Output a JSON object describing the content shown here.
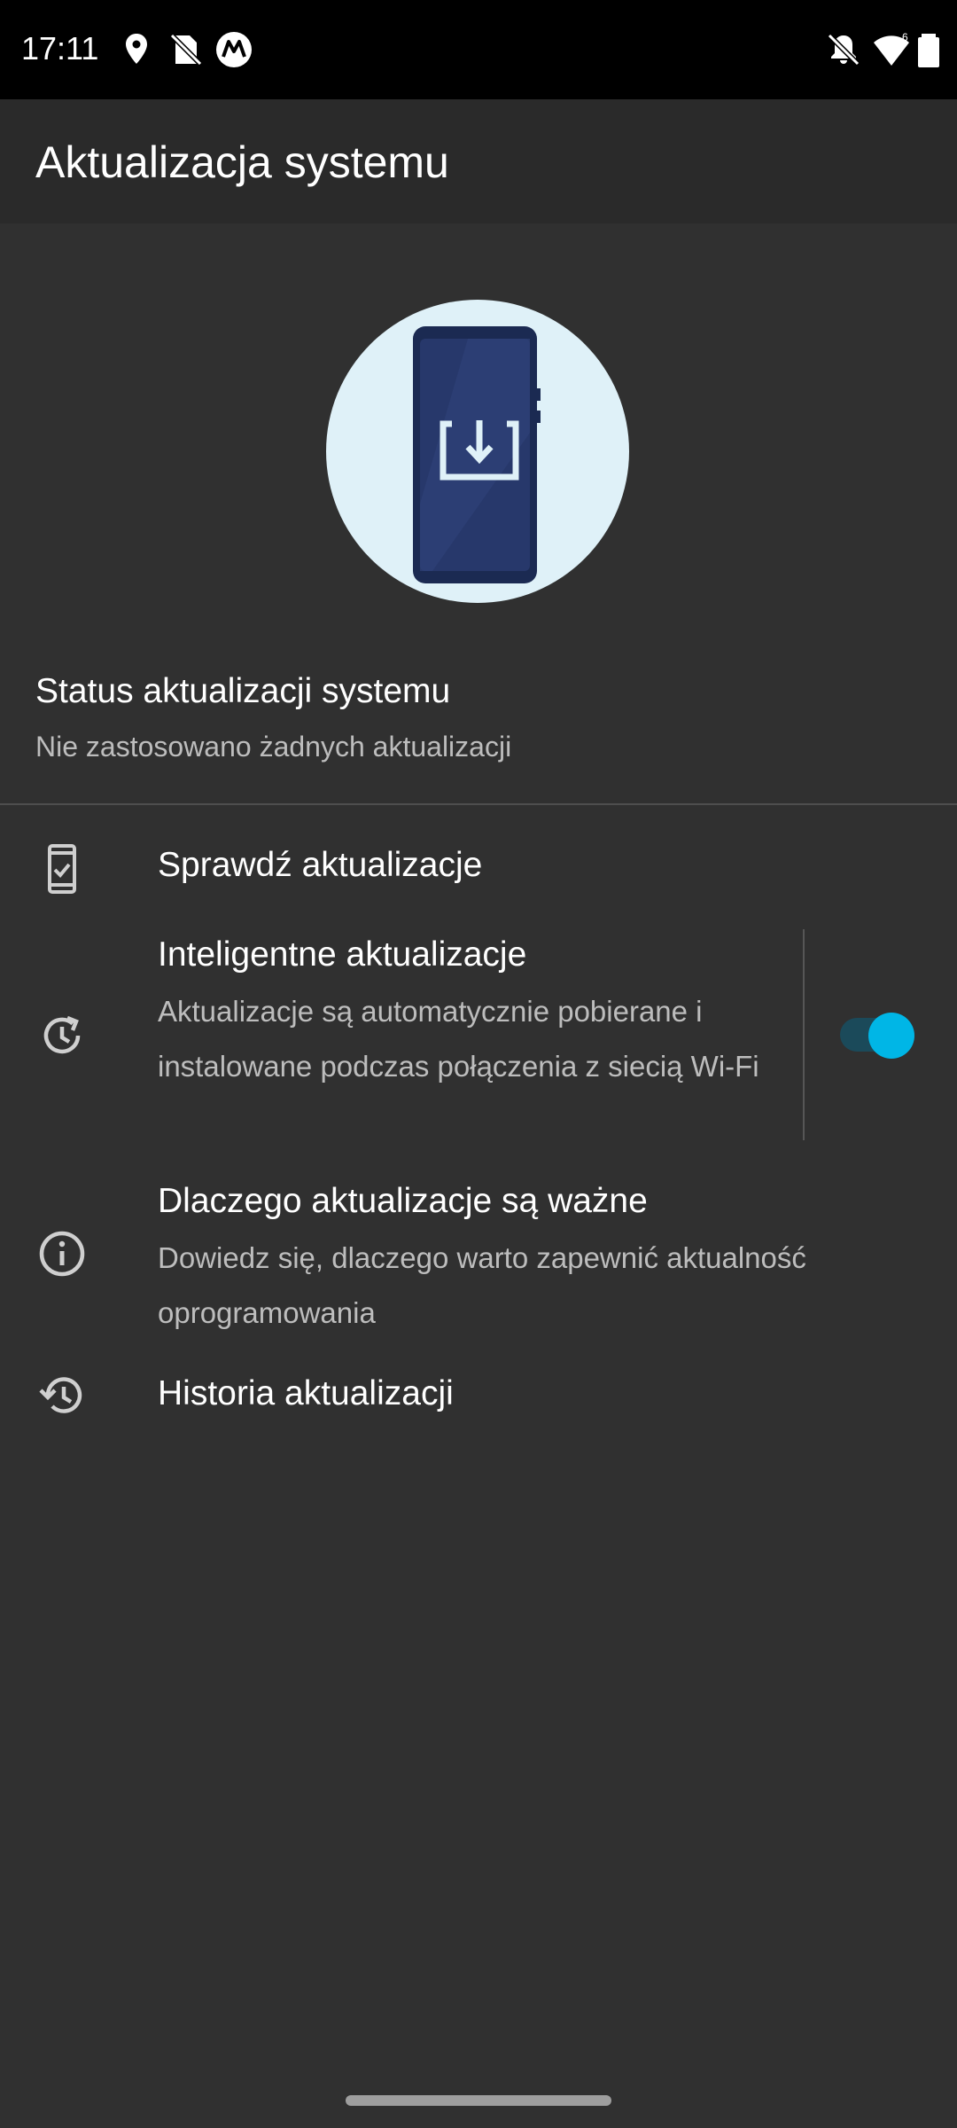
{
  "statusbar": {
    "time": "17:11",
    "icons_left": [
      "location-icon",
      "no-sim-icon",
      "motorola-icon"
    ],
    "icons_right": [
      "notifications-off-icon",
      "wifi-icon",
      "battery-icon"
    ]
  },
  "toolbar": {
    "title": "Aktualizacja systemu"
  },
  "status": {
    "title": "Status aktualizacji systemu",
    "subtitle": "Nie zastosowano żadnych aktualizacji"
  },
  "items": [
    {
      "icon": "phone-check-icon",
      "title": "Sprawdź aktualizacje"
    },
    {
      "icon": "smart-update-icon",
      "title": "Inteligentne aktualizacje",
      "subtitle": "Aktualizacje są automatycznie pobierane i instalowane podczas połączenia z siecią Wi-Fi",
      "toggle_on": true
    },
    {
      "icon": "info-icon",
      "title": "Dlaczego aktualizacje są ważne",
      "subtitle": "Dowiedz się, dlaczego warto zapewnić aktualność oprogramowania"
    },
    {
      "icon": "history-icon",
      "title": "Historia aktualizacji"
    }
  ],
  "colors": {
    "background": "#303030",
    "toolbar": "#2a2a2a",
    "accent": "#00b6e6",
    "hero_circle": "#dff1f8",
    "phone": "#1f2f5c"
  }
}
